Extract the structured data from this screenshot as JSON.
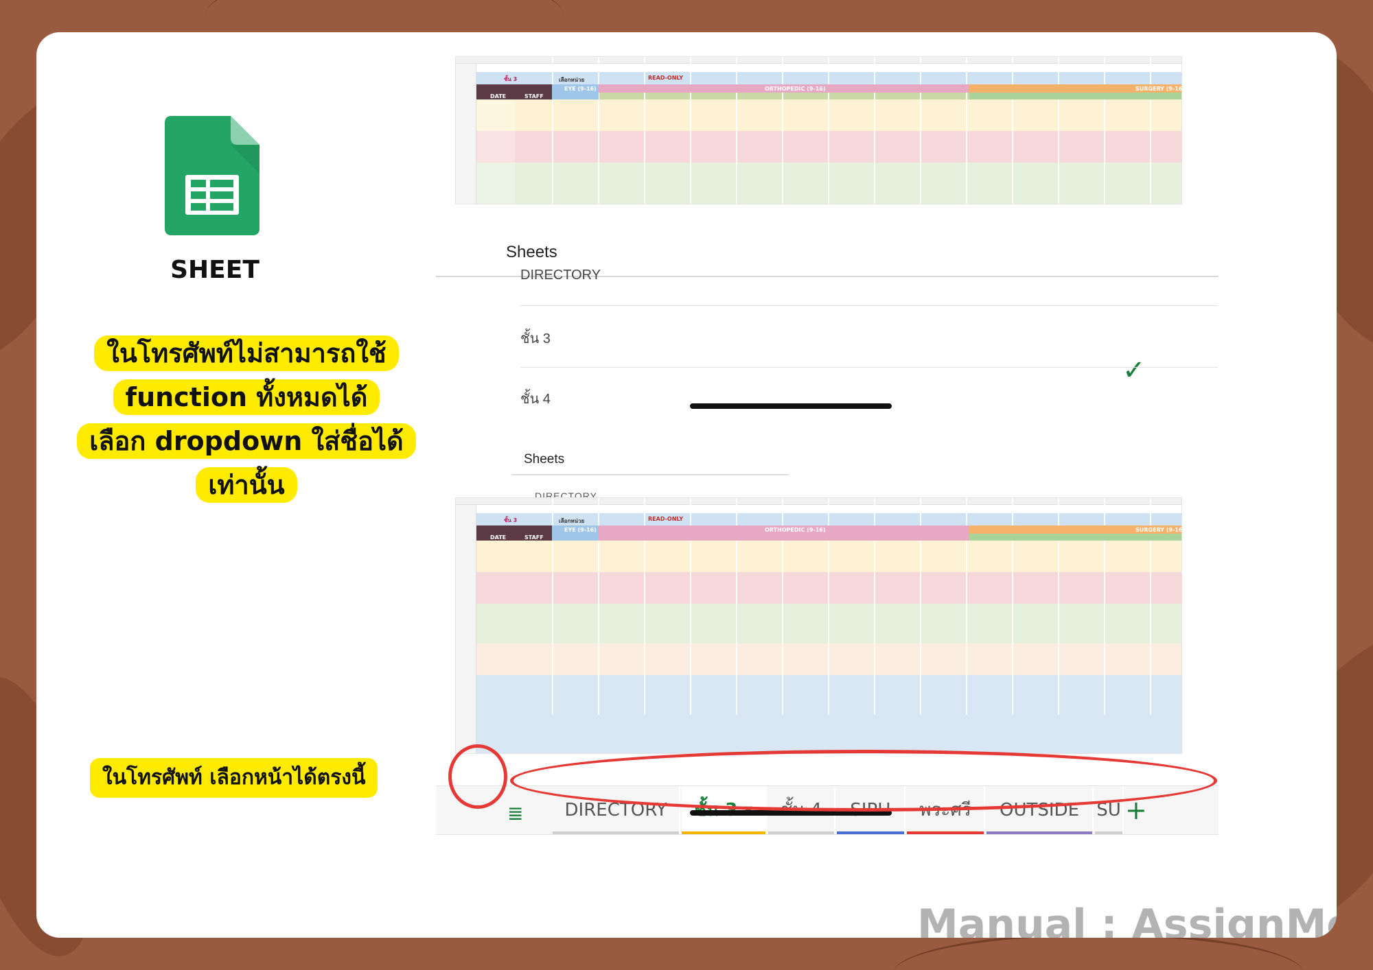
{
  "colors": {
    "background": "#9a5a3f",
    "card": "#ffffff",
    "highlight": "#ffeb00",
    "accent_green": "#188038",
    "circle_red": "#e53935",
    "brand_text": "#b3b3b3"
  },
  "logo": {
    "icon": "google-sheets-icon",
    "label": "SHEET"
  },
  "note_lines": [
    "ในโทรศัพท์ไม่สามารถใช้",
    "function ทั้งหมดได้",
    "เลือก dropdown ใส่ชื่อได้",
    "เท่านั้น"
  ],
  "note_tabs": "ในโทรศัพท์ เลือกหน้าได้ตรงนี้",
  "spreadsheet": {
    "floor_select": "ชั้น 3",
    "select_unit": "เลือกหน่วย",
    "read_only": "READ-ONLY",
    "eye": "EYE (9-16)",
    "orthopedic": "ORTHOPEDIC (9-16)",
    "surgery": "SURGERY (9-16)",
    "date": "DATE",
    "staff": "STAFF"
  },
  "sheets_panel": {
    "title": "Sheets",
    "items": [
      "DIRECTORY",
      "ชั้น 3",
      "ชั้น 4"
    ],
    "selected": "ชั้น 3",
    "title_small": "Sheets",
    "cut_item": "DIRECTORY"
  },
  "toolbar": {
    "back": "back-icon",
    "undo": "undo-icon",
    "redo": "redo-icon",
    "share": "add-person-icon",
    "comment": "comment-icon",
    "more": "more-icon"
  },
  "tabs": [
    {
      "label": "DIRECTORY",
      "underline": "#cfcfcf"
    },
    {
      "label": "ชั้น 3 ▾",
      "underline": "#f4b400",
      "active": true
    },
    {
      "label": "ชั้น 4",
      "underline": "#cfcfcf"
    },
    {
      "label": "SIPH",
      "underline": "#4a6fd6"
    },
    {
      "label": "พระศรี",
      "underline": "#e53935"
    },
    {
      "label": "OUTSIDE",
      "underline": "#8e7cc3"
    },
    {
      "label": "SU",
      "underline": "#cfcfcf"
    }
  ],
  "brand": "Manual : AssignMe Board"
}
